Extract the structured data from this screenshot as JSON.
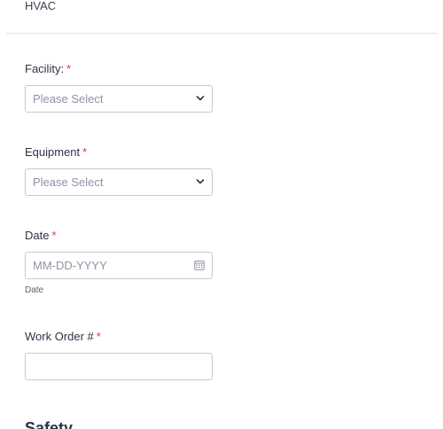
{
  "header": {
    "text": "HVAC"
  },
  "fields": {
    "facility": {
      "label": "Facility:",
      "required_mark": "*",
      "placeholder": "Please Select"
    },
    "equipment": {
      "label": "Equipment",
      "required_mark": "*",
      "placeholder": "Please Select"
    },
    "date": {
      "label": "Date",
      "required_mark": "*",
      "placeholder": "MM-DD-YYYY",
      "sublabel": "Date"
    },
    "work_order": {
      "label": "Work Order #",
      "required_mark": "*",
      "value": ""
    }
  },
  "section": {
    "title": "Safety"
  },
  "colors": {
    "required": "#e53935",
    "border": "#c3cad8",
    "placeholder": "#8d93a3"
  },
  "icons": {
    "select": "chevron-down-icon",
    "date": "calendar-icon"
  }
}
